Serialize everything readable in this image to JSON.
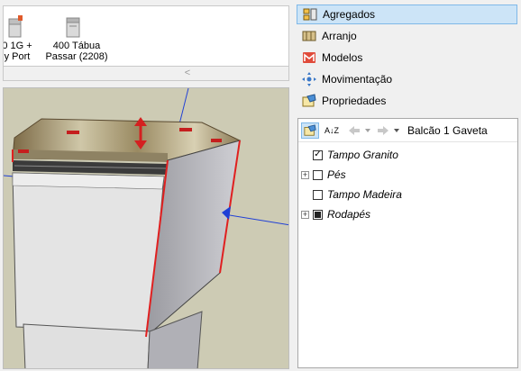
{
  "library": {
    "items": [
      {
        "caption": "0 1G +\ny Port"
      },
      {
        "caption": "400 Tábua\nPassar (2208)"
      }
    ],
    "scroll_left_glyph": "<"
  },
  "panel": {
    "nav": [
      {
        "label": "Agregados",
        "icon": "agregados-icon",
        "selected": true
      },
      {
        "label": "Arranjo",
        "icon": "arranjo-icon"
      },
      {
        "label": "Modelos",
        "icon": "modelos-icon"
      },
      {
        "label": "Movimentação",
        "icon": "movimentacao-icon"
      },
      {
        "label": "Propriedades",
        "icon": "propriedades-icon"
      }
    ],
    "tree_toolbar": {
      "sort_label": "A↓Z",
      "current_component": "Balcão 1 Gaveta"
    },
    "tree": [
      {
        "label": "Tampo Granito",
        "checked": true,
        "expander": false
      },
      {
        "label": "Pés",
        "checked": false,
        "expander": true
      },
      {
        "label": "Tampo Madeira",
        "checked": false,
        "expander": false
      },
      {
        "label": "Rodapés",
        "partial": true,
        "expander": true
      }
    ]
  },
  "colors": {
    "viewport_bg": "#cdcbb4",
    "selection": "#cce4f7",
    "highlight_edge": "#e02020",
    "axis_blue": "#1f3fd6"
  }
}
